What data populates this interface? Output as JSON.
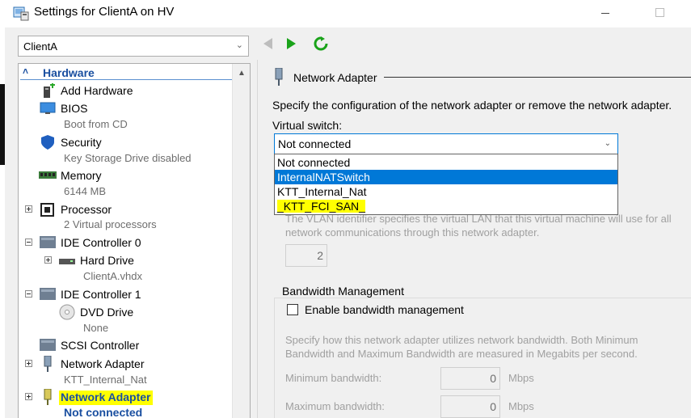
{
  "window": {
    "title": "Settings for ClientA on HV"
  },
  "vm_selector": {
    "value": "ClientA"
  },
  "tree": {
    "section": "Hardware",
    "items": [
      {
        "label": "Add Hardware"
      },
      {
        "label": "BIOS",
        "sub": "Boot from CD"
      },
      {
        "label": "Security",
        "sub": "Key Storage Drive disabled"
      },
      {
        "label": "Memory",
        "sub": "6144 MB"
      },
      {
        "label": "Processor",
        "sub": "2 Virtual processors"
      },
      {
        "label": "IDE Controller 0"
      },
      {
        "label": "Hard Drive",
        "sub": "ClientA.vhdx"
      },
      {
        "label": "IDE Controller 1"
      },
      {
        "label": "DVD Drive",
        "sub": "None"
      },
      {
        "label": "SCSI Controller"
      },
      {
        "label": "Network Adapter",
        "sub": "KTT_Internal_Nat"
      },
      {
        "label": "Network Adapter",
        "sub": "Not connected"
      }
    ]
  },
  "panel": {
    "group_title": "Network Adapter",
    "description": "Specify the configuration of the network adapter or remove the network adapter.",
    "virtual_switch_label": "Virtual switch:",
    "virtual_switch_value": "Not connected",
    "dropdown_options": [
      "Not connected",
      "InternalNATSwitch",
      "KTT_Internal_Nat",
      "_KTT_FCI_SAN_"
    ],
    "vlan_text_1": "The VLAN identifier specifies the virtual LAN that this virtual machine will use for all",
    "vlan_text_2": "network communications through this network adapter.",
    "vlan_value": "2",
    "bandwidth_title": "Bandwidth Management",
    "bandwidth_checkbox": "Enable bandwidth management",
    "bandwidth_desc_1": "Specify how this network adapter utilizes network bandwidth. Both Minimum",
    "bandwidth_desc_2": "Bandwidth and Maximum Bandwidth are measured in Megabits per second.",
    "min_label": "Minimum bandwidth:",
    "min_value": "0",
    "max_label": "Maximum bandwidth:",
    "max_value": "0",
    "unit": "Mbps"
  },
  "colors": {
    "accent": "#0078d7",
    "highlight": "#ffff00",
    "link": "#1a4fa0"
  }
}
